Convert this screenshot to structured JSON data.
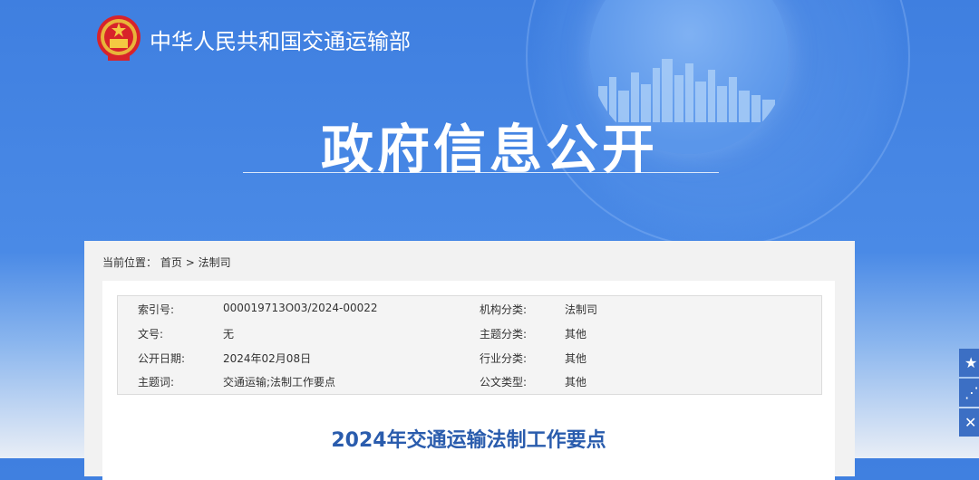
{
  "header": {
    "ministry_name": "中华人民共和国交通运输部",
    "section_title": "政府信息公开"
  },
  "breadcrumb": {
    "prefix": "当前位置：",
    "home": "首页",
    "separator": ">",
    "current": "法制司"
  },
  "meta": {
    "rows": [
      {
        "label1": "索引号:",
        "value1": "000019713O03/2024-00022",
        "label2": "机构分类:",
        "value2": "法制司"
      },
      {
        "label1": "文号:",
        "value1": "无",
        "label2": "主题分类:",
        "value2": "其他"
      },
      {
        "label1": "公开日期:",
        "value1": "2024年02月08日",
        "label2": "行业分类:",
        "value2": "其他"
      },
      {
        "label1": "主题词:",
        "value1": "交通运输;法制工作要点",
        "label2": "公文类型:",
        "value2": "其他"
      }
    ]
  },
  "document": {
    "title": "2024年交通运输法制工作要点"
  },
  "side_tools": [
    {
      "icon": "star-icon",
      "glyph": "★"
    },
    {
      "icon": "share-icon",
      "glyph": "⋰"
    },
    {
      "icon": "close-icon",
      "glyph": "✕"
    }
  ],
  "colors": {
    "hero_blue": "#3f7fe0",
    "title_blue": "#2a5cad",
    "side_button": "#3c6fc4"
  }
}
